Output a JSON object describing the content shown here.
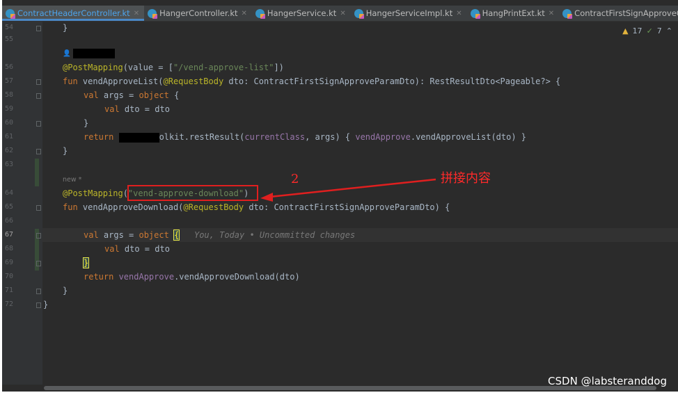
{
  "tabs": [
    {
      "label": "ContractHeaderController.kt",
      "active": true
    },
    {
      "label": "HangerController.kt",
      "active": false
    },
    {
      "label": "HangerService.kt",
      "active": false
    },
    {
      "label": "HangerServiceImpl.kt",
      "active": false
    },
    {
      "label": "HangPrintExt.kt",
      "active": false
    },
    {
      "label": "ContractFirstSignApproveC",
      "active": false
    }
  ],
  "inspections": {
    "warnings": "17",
    "weak_warnings": "7"
  },
  "line_numbers": [
    "54",
    "55",
    "56",
    "57",
    "58",
    "59",
    "60",
    "61",
    "62",
    "63",
    "64",
    "65",
    "66",
    "67",
    "68",
    "69",
    "70",
    "71",
    "72"
  ],
  "current_line": "67",
  "meta": {
    "new_marker": "new *"
  },
  "code": {
    "l54": "}",
    "l56_ann": "@PostMapping",
    "l56_a": "(value = [",
    "l56_str": "\"/vend-approve-list\"",
    "l56_b": "])",
    "l57_kw": "fun ",
    "l57_a": "vendApproveList(",
    "l57_ann": "@RequestBody",
    "l57_b": " dto: ContractFirstSignApproveParamDto): RestResultDto<Pageable?> {",
    "l58_kw": "val ",
    "l58_a": "args = ",
    "l58_kw2": "object",
    "l58_b": " {",
    "l59_kw": "val ",
    "l59_a": "dto = dto",
    "l60": "}",
    "l61_kw": "return ",
    "l61_a": "olkit.restResult(",
    "l61_fld": "currentClass",
    "l61_b": ", args) { ",
    "l61_fld2": "vendApprove",
    "l61_c": ".vendApproveList(dto) }",
    "l62": "}",
    "l64_ann": "@PostMapping",
    "l64_a": "(",
    "l64_str": "\"vend-approve-download\"",
    "l64_b": ")",
    "l65_kw": "fun ",
    "l65_a": "vendApproveDownload(",
    "l65_ann": "@RequestBody",
    "l65_b": " dto: ContractFirstSignApproveParamDto) {",
    "l67_kw": "val ",
    "l67_a": "args = ",
    "l67_kw2": "object",
    "l67_sp": " ",
    "l67_brace": "{",
    "l67_hint": "   You, Today • Uncommitted changes",
    "l68_kw": "val ",
    "l68_a": "dto = dto",
    "l69_brace": "}",
    "l70_kw": "return ",
    "l70_fld": "vendApprove",
    "l70_a": ".vendApproveDownload(dto)",
    "l71": "}",
    "l72": "}"
  },
  "annotation": {
    "number": "2",
    "label": "拼接内容",
    "color": "#ff2a2a"
  },
  "watermark": "CSDN @labsteranddog"
}
